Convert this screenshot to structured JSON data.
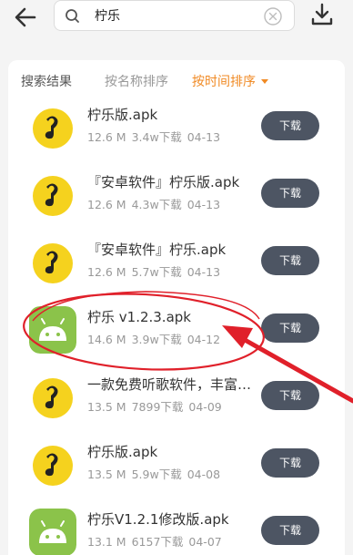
{
  "search": {
    "query": "柠乐"
  },
  "tabs": [
    {
      "label": "搜索结果"
    },
    {
      "label": "按名称排序"
    },
    {
      "label": "按时间排序"
    }
  ],
  "results": [
    {
      "title": "柠乐版.apk",
      "size": "12.6 M",
      "downloads": "3.4w下载",
      "date": "04-13",
      "icon": "yellow-music-app-icon"
    },
    {
      "title": "『安卓软件』柠乐版.apk",
      "size": "12.6 M",
      "downloads": "4.3w下载",
      "date": "04-13",
      "icon": "yellow-music-app-icon"
    },
    {
      "title": "『安卓软件』柠乐.apk",
      "size": "12.6 M",
      "downloads": "5.7w下载",
      "date": "04-13",
      "icon": "yellow-music-app-icon"
    },
    {
      "title": "柠乐 v1.2.3.apk",
      "size": "14.6 M",
      "downloads": "3.9w下载",
      "date": "04-12",
      "icon": "android-icon"
    },
    {
      "title": "一款免费听歌软件，丰富…",
      "size": "13.5 M",
      "downloads": "7899下载",
      "date": "04-09",
      "icon": "yellow-music-app-icon"
    },
    {
      "title": "柠乐版.apk",
      "size": "13.5 M",
      "downloads": "5.9w下载",
      "date": "04-08",
      "icon": "yellow-music-app-icon"
    },
    {
      "title": "柠乐V1.2.1修改版.apk",
      "size": "13.1 M",
      "downloads": "6157下载",
      "date": "04-07",
      "icon": "android-icon"
    }
  ],
  "download_label": "下载",
  "colors": {
    "accent": "#f08a24",
    "button": "#4d5563",
    "annotation": "#e0202a",
    "app_yellow": "#f5d21e",
    "android_green": "#8bc34a"
  }
}
